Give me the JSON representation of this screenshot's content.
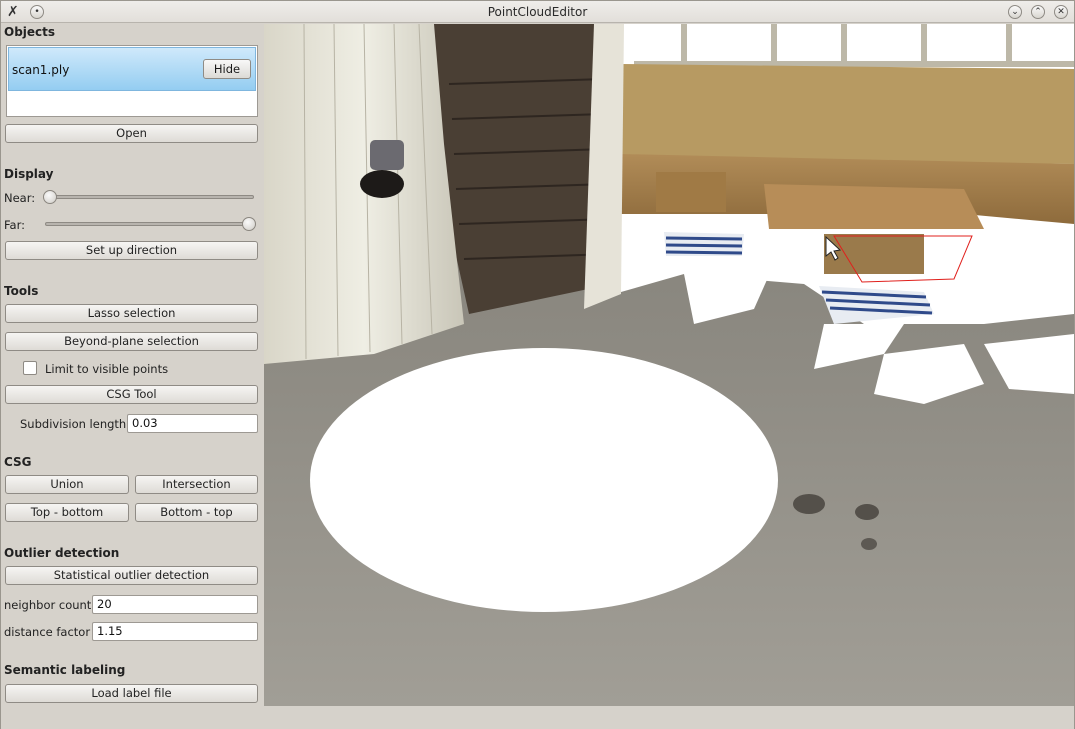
{
  "window": {
    "title": "PointCloudEditor"
  },
  "objects": {
    "heading": "Objects",
    "items": [
      {
        "name": "scan1.ply",
        "hide_label": "Hide"
      }
    ],
    "open_label": "Open"
  },
  "display": {
    "heading": "Display",
    "near_label": "Near:",
    "far_label": "Far:",
    "near_value": 0.0,
    "far_value": 1.0,
    "setup_direction_label": "Set up direction"
  },
  "tools": {
    "heading": "Tools",
    "lasso_label": "Lasso selection",
    "beyond_plane_label": "Beyond-plane selection",
    "limit_visible_label": "Limit to visible points",
    "limit_visible_checked": false,
    "csg_tool_label": "CSG Tool",
    "subdivision_label": "Subdivision length:",
    "subdivision_value": "0.03"
  },
  "csg": {
    "heading": "CSG",
    "union_label": "Union",
    "intersection_label": "Intersection",
    "top_bottom_label": "Top - bottom",
    "bottom_top_label": "Bottom - top"
  },
  "outlier": {
    "heading": "Outlier detection",
    "statistical_label": "Statistical outlier detection",
    "neighbor_count_label": "neighbor count",
    "neighbor_count_value": "20",
    "distance_factor_label": "distance factor",
    "distance_factor_value": "1.15"
  },
  "semantic": {
    "heading": "Semantic labeling",
    "load_label_file_label": "Load label file"
  },
  "colors": {
    "selection_outline": "#e0201c",
    "list_selection": "#94cdf1"
  }
}
